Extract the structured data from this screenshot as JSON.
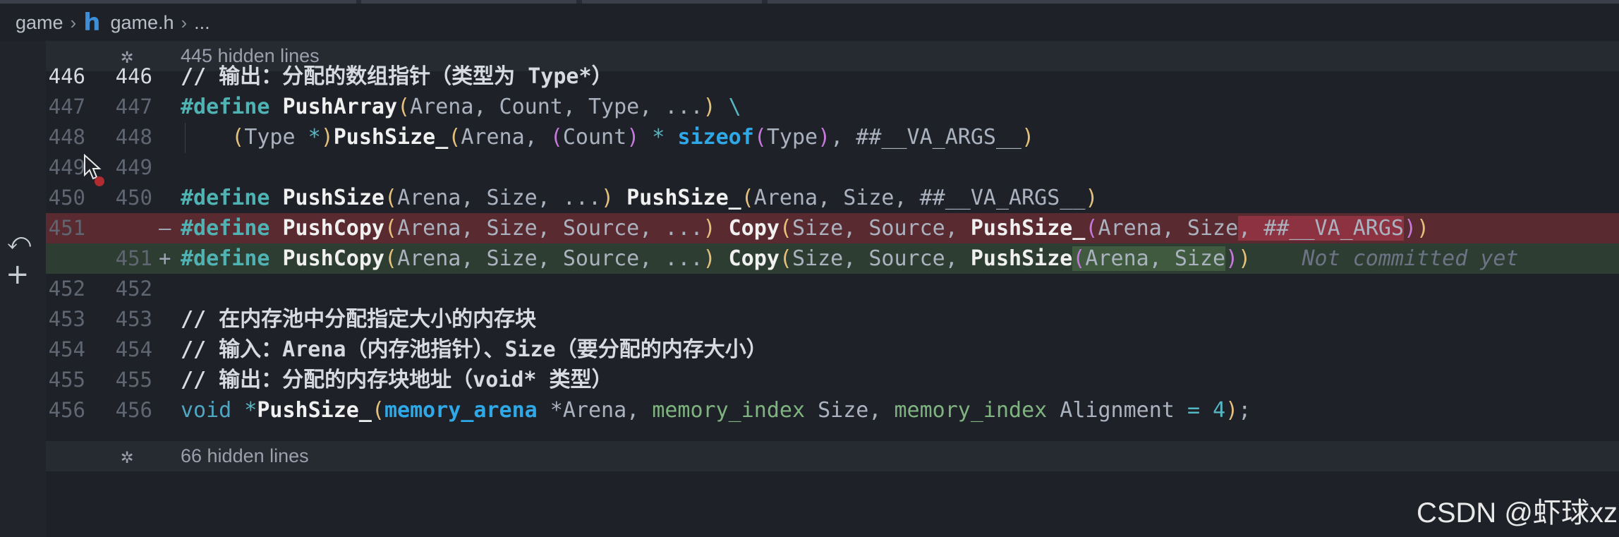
{
  "breadcrumb": {
    "folder": "game",
    "file_icon_glyph": "h",
    "file": "game.h",
    "more": "...",
    "separator": "›"
  },
  "folds": {
    "top": "445 hidden lines",
    "bottom": "66 hidden lines",
    "icon_glyph": "✲"
  },
  "lines": {
    "l446": {
      "old": "446",
      "new": "446"
    },
    "l447": {
      "old": "447",
      "new": "447"
    },
    "l448": {
      "old": "448",
      "new": "448"
    },
    "l449": {
      "old": "449",
      "new": "449"
    },
    "l450": {
      "old": "450",
      "new": "450"
    },
    "l451del": {
      "old": "451",
      "marker": "—"
    },
    "l451add": {
      "new": "451",
      "marker": "+"
    },
    "l452": {
      "old": "452",
      "new": "452"
    },
    "l453": {
      "old": "453",
      "new": "453"
    },
    "l454": {
      "old": "454",
      "new": "454"
    },
    "l455": {
      "old": "455",
      "new": "455"
    },
    "l456": {
      "old": "456",
      "new": "456"
    }
  },
  "code": {
    "c446": "// 输出：分配的数组指针（类型为 Type*）",
    "c447": {
      "kw": "#define",
      "name": "PushArray",
      "open": "(",
      "args": "Arena, Count, Type, ...",
      "close": ")",
      "cont": " \\"
    },
    "c448": {
      "indent": "    ",
      "p_open": "(",
      "type": "Type ",
      "star": "*",
      "p_close": ")",
      "fn": "PushSize_",
      "p2_open": "(",
      "a1": "Arena, ",
      "p3_open": "(",
      "count": "Count",
      "p3_close": ")",
      "mul": " * ",
      "sizeof": "sizeof",
      "p4_open": "(",
      "type2": "Type",
      "p4_close": ")",
      "rest": ", ##__VA_ARGS__",
      "p2_close": ")"
    },
    "c450": {
      "kw": "#define",
      "name": "PushSize",
      "open": "(",
      "args": "Arena, Size, ...",
      "close": ")",
      "fn": "PushSize_",
      "open2": "(",
      "args2": "Arena, Size, ##__VA_ARGS__",
      "close2": ")"
    },
    "c451del": {
      "kw": "#define",
      "name": "PushCopy",
      "open": "(",
      "args": "Arena, Size, Source, ...",
      "close": ")",
      "fn": "Copy",
      "open2": "(",
      "args2": "Size, Source, ",
      "fn2": "PushSize_",
      "open3": "(",
      "args3": "Arena, Size",
      "hl": ", ##__VA_ARGS",
      "close3": ")",
      "close2": ")"
    },
    "c451add": {
      "kw": "#define",
      "name": "PushCopy",
      "open": "(",
      "args": "Arena, Size, Source, ...",
      "close": ")",
      "fn": "Copy",
      "open2": "(",
      "args2": "Size, Source, ",
      "fn2": "PushSize",
      "open3": "(",
      "args3": "Arena, Size",
      "close3": ")",
      "close2": ")",
      "blame": "Not committed yet"
    },
    "c453": "// 在内存池中分配指定大小的内存块",
    "c454": "// 输入：Arena（内存池指针）、Size（要分配的内存大小）",
    "c455": "// 输出：分配的内存块地址（void* 类型）",
    "c456": {
      "void": "void",
      "star": " *",
      "fn": "PushSize_",
      "open": "(",
      "t1": "memory_arena",
      "a1": " *Arena, ",
      "t2": "memory_index",
      "a2": " Size, ",
      "t3": "memory_index",
      "a3": " Alignment ",
      "eq": "=",
      "sp": " ",
      "num": "4",
      "close": ")",
      "semi": ";"
    }
  },
  "gutter": {
    "revert_glyph": "⤺",
    "plus_glyph": "+"
  },
  "watermark": "CSDN @虾球xz",
  "colors": {
    "background": "#1e2228",
    "removed_line": "#5a2a31",
    "added_line": "#2e3d31",
    "keyword": "#4fb3b3",
    "breakpoint": "#b02c30"
  }
}
